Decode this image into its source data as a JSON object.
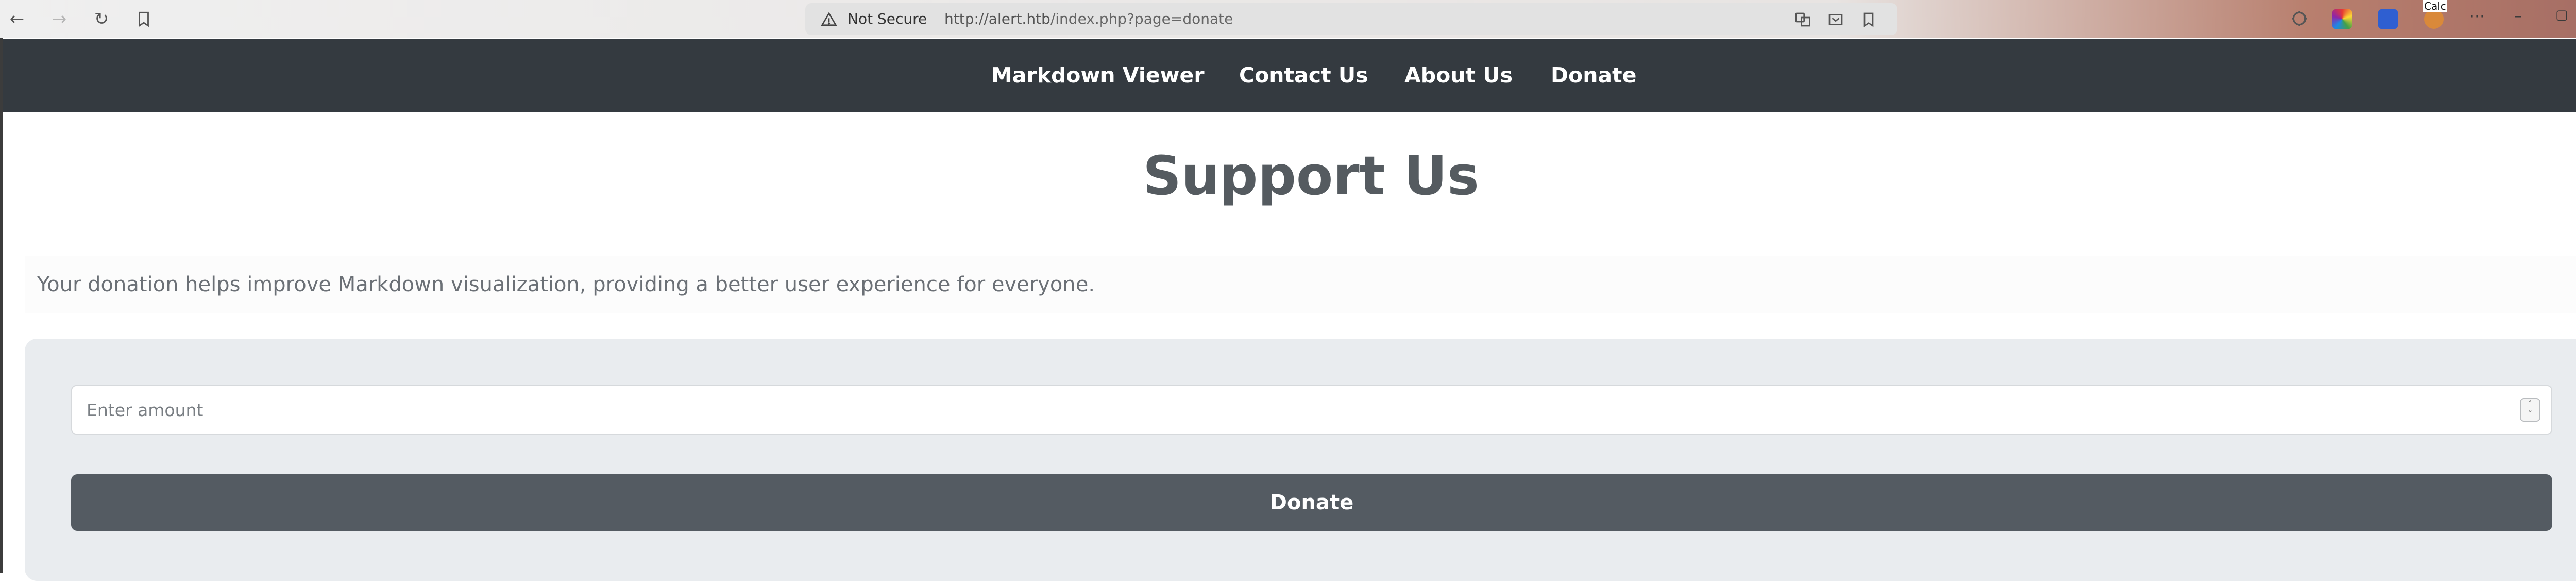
{
  "browser": {
    "security_label": "Not Secure",
    "url_host": "http://alert.htb",
    "url_path": "/index.php?page=donate",
    "extension_badge": "Calc"
  },
  "nav": {
    "items": [
      "Markdown Viewer",
      "Contact Us",
      "About Us",
      "Donate"
    ]
  },
  "page": {
    "title": "Support Us",
    "description": "Your donation helps improve Markdown visualization, providing a better user experience for everyone."
  },
  "form": {
    "amount_placeholder": "Enter amount",
    "amount_value": "",
    "submit_label": "Donate"
  },
  "colors": {
    "nav_bg": "#343a40",
    "button_bg": "#545b62",
    "card_bg": "#e9ecef"
  }
}
